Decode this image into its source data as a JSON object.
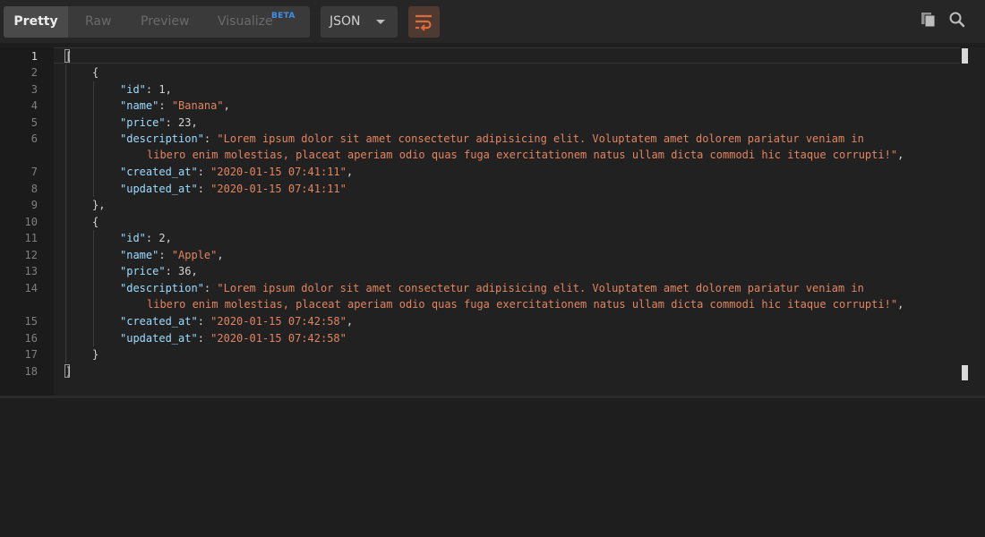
{
  "toolbar": {
    "tabs": {
      "pretty": "Pretty",
      "raw": "Raw",
      "preview": "Preview",
      "visualize": "Visualize",
      "visualize_badge": "BETA"
    },
    "format": "JSON",
    "wrap_icon": "text-wrap-icon",
    "copy_icon": "copy-icon",
    "search_icon": "search-icon",
    "accent_color": "#e0693a"
  },
  "editor": {
    "line_numbers": [
      "1",
      "2",
      "3",
      "4",
      "5",
      "6",
      "7",
      "8",
      "9",
      "10",
      "11",
      "12",
      "13",
      "14",
      "15",
      "16",
      "17",
      "18"
    ],
    "lines": {
      "l1": "[",
      "l2": "{",
      "l3_key": "\"id\"",
      "l3_val": "1",
      "l4_key": "\"name\"",
      "l4_val": "\"Banana\"",
      "l5_key": "\"price\"",
      "l5_val": "23",
      "l6_key": "\"description\"",
      "l6_val_a": "\"Lorem ipsum dolor sit amet consectetur adipisicing elit. Voluptatem amet dolorem pariatur veniam in",
      "l6_val_b": "libero enim molestias, placeat aperiam odio quas fuga exercitationem natus ullam dicta commodi hic itaque corrupti!\"",
      "l7_key": "\"created_at\"",
      "l7_val": "\"2020-01-15 07:41:11\"",
      "l8_key": "\"updated_at\"",
      "l8_val": "\"2020-01-15 07:41:11\"",
      "l9": "},",
      "l10": "{",
      "l11_key": "\"id\"",
      "l11_val": "2",
      "l12_key": "\"name\"",
      "l12_val": "\"Apple\"",
      "l13_key": "\"price\"",
      "l13_val": "36",
      "l14_key": "\"description\"",
      "l14_val_a": "\"Lorem ipsum dolor sit amet consectetur adipisicing elit. Voluptatem amet dolorem pariatur veniam in",
      "l14_val_b": "libero enim molestias, placeat aperiam odio quas fuga exercitationem natus ullam dicta commodi hic itaque corrupti!\"",
      "l15_key": "\"created_at\"",
      "l15_val": "\"2020-01-15 07:42:58\"",
      "l16_key": "\"updated_at\"",
      "l16_val": "\"2020-01-15 07:42:58\"",
      "l17": "}",
      "l18": "]"
    }
  }
}
